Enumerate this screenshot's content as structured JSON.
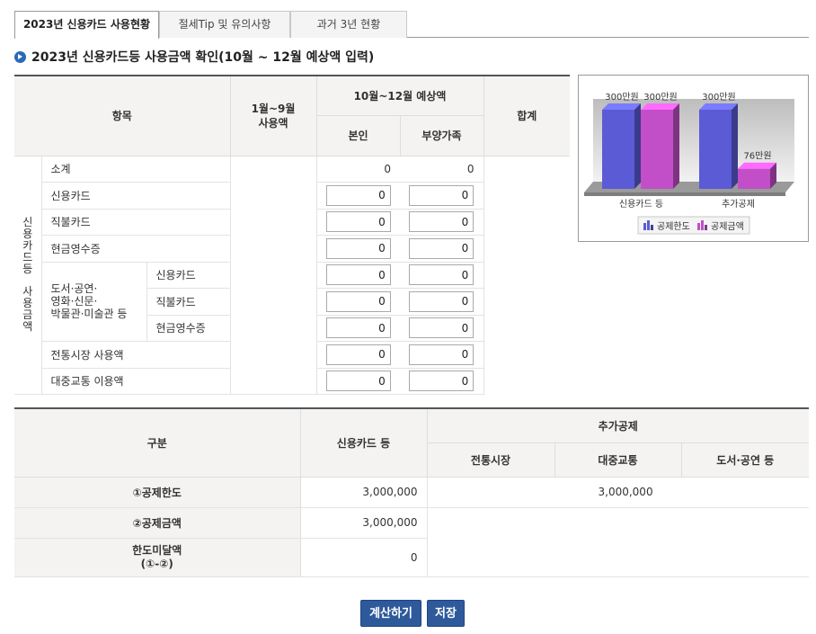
{
  "tabs": [
    {
      "label": "2023년 신용카드 사용현황",
      "active": true
    },
    {
      "label": "절세Tip 및 유의사항",
      "active": false
    },
    {
      "label": "과거 3년 현황",
      "active": false
    }
  ],
  "section_title": "2023년 신용카드등 사용금액 확인(10월 ~ 12월 예상액 입력)",
  "table1": {
    "headers": {
      "item": "항목",
      "jan_sep_line1": "1월~9월",
      "jan_sep_line2": "사용액",
      "oct_dec": "10월~12월 예상액",
      "self": "본인",
      "dependent": "부양가족",
      "total": "합계"
    },
    "side_label": "신용카드등 사용금액",
    "rows": [
      {
        "label": "소계",
        "self": "0",
        "dependent": "0"
      },
      {
        "label": "신용카드",
        "self": "0",
        "dependent": "0"
      },
      {
        "label": "직불카드",
        "self": "0",
        "dependent": "0"
      },
      {
        "label": "현금영수증",
        "self": "0",
        "dependent": "0"
      }
    ],
    "culture_group": {
      "label_line1": "도서·공연·",
      "label_line2": "영화·신문·",
      "label_line3": "박물관·미술관 등",
      "rows": [
        {
          "label": "신용카드",
          "self": "0",
          "dependent": "0"
        },
        {
          "label": "직불카드",
          "self": "0",
          "dependent": "0"
        },
        {
          "label": "현금영수증",
          "self": "0",
          "dependent": "0"
        }
      ]
    },
    "tail_rows": [
      {
        "label": "전통시장 사용액",
        "self": "0",
        "dependent": "0"
      },
      {
        "label": "대중교통 이용액",
        "self": "0",
        "dependent": "0"
      }
    ]
  },
  "chart_data": {
    "type": "bar",
    "categories": [
      "신용카드 등",
      "추가공제"
    ],
    "series": [
      {
        "name": "공제한도",
        "values": [
          300,
          300
        ],
        "color": "#5b5bd6"
      },
      {
        "name": "공제금액",
        "values": [
          300,
          76
        ],
        "color": "#c24fc8"
      }
    ],
    "data_labels": [
      [
        "300만원",
        "300만원"
      ],
      [
        "300만원",
        "76만원"
      ]
    ],
    "ylim": [
      0,
      300
    ],
    "legend": "bottom",
    "grid": false
  },
  "table2": {
    "headers": {
      "category": "구분",
      "credit": "신용카드 등",
      "additional": "추가공제",
      "market": "전통시장",
      "transit": "대중교통",
      "culture": "도서·공연 등"
    },
    "rows": [
      {
        "label": "①공제한도",
        "credit": "3,000,000",
        "additional": "3,000,000"
      },
      {
        "label": "②공제금액",
        "credit": "3,000,000"
      },
      {
        "label_line1": "한도미달액",
        "label_line2": "(①-②)",
        "credit": "0"
      }
    ]
  },
  "buttons": {
    "calculate": "계산하기",
    "save": "저장"
  }
}
